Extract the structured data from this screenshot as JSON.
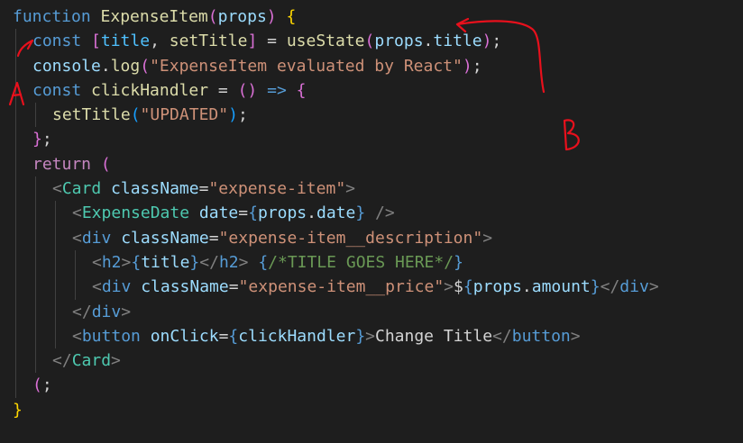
{
  "editor": {
    "language": "javascript-jsx",
    "theme": {
      "background": "#1e1e1e",
      "indent_guide": "#404040",
      "annotation_ink": "#e8101c"
    },
    "lines": [
      {
        "indent": 0,
        "tokens": [
          [
            "function",
            "#569cd6"
          ],
          [
            " ",
            "#d4d4d4"
          ],
          [
            "ExpenseItem",
            "#dcdcaa"
          ],
          [
            "(",
            "#da70d6"
          ],
          [
            "props",
            "#9cdcfe"
          ],
          [
            ")",
            "#da70d6"
          ],
          [
            " ",
            "#d4d4d4"
          ],
          [
            "{",
            "#ffd700"
          ]
        ]
      },
      {
        "indent": 1,
        "tokens": [
          [
            "const",
            "#569cd6"
          ],
          [
            " ",
            "#d4d4d4"
          ],
          [
            "[",
            "#da70d6"
          ],
          [
            "title",
            "#4fc1ff"
          ],
          [
            ", ",
            "#d4d4d4"
          ],
          [
            "setTitle",
            "#dcdcaa"
          ],
          [
            "]",
            "#da70d6"
          ],
          [
            " = ",
            "#d4d4d4"
          ],
          [
            "useState",
            "#dcdcaa"
          ],
          [
            "(",
            "#da70d6"
          ],
          [
            "props",
            "#9cdcfe"
          ],
          [
            ".",
            "#d4d4d4"
          ],
          [
            "title",
            "#9cdcfe"
          ],
          [
            ")",
            "#da70d6"
          ],
          [
            ";",
            "#d4d4d4"
          ]
        ]
      },
      {
        "indent": 1,
        "tokens": [
          [
            "console",
            "#9cdcfe"
          ],
          [
            ".",
            "#d4d4d4"
          ],
          [
            "log",
            "#dcdcaa"
          ],
          [
            "(",
            "#da70d6"
          ],
          [
            "\"ExpenseItem evaluated by React\"",
            "#ce9178"
          ],
          [
            ")",
            "#da70d6"
          ],
          [
            ";",
            "#d4d4d4"
          ]
        ]
      },
      {
        "indent": 1,
        "tokens": [
          [
            "const",
            "#569cd6"
          ],
          [
            " ",
            "#d4d4d4"
          ],
          [
            "clickHandler",
            "#dcdcaa"
          ],
          [
            " = ",
            "#d4d4d4"
          ],
          [
            "()",
            "#da70d6"
          ],
          [
            " ",
            "#d4d4d4"
          ],
          [
            "=>",
            "#569cd6"
          ],
          [
            " ",
            "#d4d4d4"
          ],
          [
            "{",
            "#da70d6"
          ]
        ]
      },
      {
        "indent": 2,
        "tokens": [
          [
            "setTitle",
            "#dcdcaa"
          ],
          [
            "(",
            "#179fff"
          ],
          [
            "\"UPDATED\"",
            "#ce9178"
          ],
          [
            ")",
            "#179fff"
          ],
          [
            ";",
            "#d4d4d4"
          ]
        ]
      },
      {
        "indent": 1,
        "tokens": [
          [
            "}",
            "#da70d6"
          ],
          [
            ";",
            "#d4d4d4"
          ]
        ]
      },
      {
        "indent": 1,
        "tokens": [
          [
            "return",
            "#c586c0"
          ],
          [
            " ",
            "#d4d4d4"
          ],
          [
            "(",
            "#da70d6"
          ]
        ]
      },
      {
        "indent": 2,
        "tokens": [
          [
            "<",
            "#808080"
          ],
          [
            "Card",
            "#4ec9b0"
          ],
          [
            " ",
            "#d4d4d4"
          ],
          [
            "className",
            "#9cdcfe"
          ],
          [
            "=",
            "#d4d4d4"
          ],
          [
            "\"expense-item\"",
            "#ce9178"
          ],
          [
            ">",
            "#808080"
          ]
        ]
      },
      {
        "indent": 3,
        "tokens": [
          [
            "<",
            "#808080"
          ],
          [
            "ExpenseDate",
            "#4ec9b0"
          ],
          [
            " ",
            "#d4d4d4"
          ],
          [
            "date",
            "#9cdcfe"
          ],
          [
            "=",
            "#d4d4d4"
          ],
          [
            "{",
            "#569cd6"
          ],
          [
            "props",
            "#9cdcfe"
          ],
          [
            ".",
            "#d4d4d4"
          ],
          [
            "date",
            "#9cdcfe"
          ],
          [
            "}",
            "#569cd6"
          ],
          [
            " ",
            "#d4d4d4"
          ],
          [
            "/>",
            "#808080"
          ]
        ]
      },
      {
        "indent": 3,
        "tokens": [
          [
            "<",
            "#808080"
          ],
          [
            "div",
            "#569cd6"
          ],
          [
            " ",
            "#d4d4d4"
          ],
          [
            "className",
            "#9cdcfe"
          ],
          [
            "=",
            "#d4d4d4"
          ],
          [
            "\"expense-item__description\"",
            "#ce9178"
          ],
          [
            ">",
            "#808080"
          ]
        ]
      },
      {
        "indent": 4,
        "tokens": [
          [
            "<",
            "#808080"
          ],
          [
            "h2",
            "#569cd6"
          ],
          [
            ">",
            "#808080"
          ],
          [
            "{",
            "#569cd6"
          ],
          [
            "title",
            "#9cdcfe"
          ],
          [
            "}",
            "#569cd6"
          ],
          [
            "</",
            "#808080"
          ],
          [
            "h2",
            "#569cd6"
          ],
          [
            ">",
            "#808080"
          ],
          [
            " ",
            "#d4d4d4"
          ],
          [
            "{",
            "#569cd6"
          ],
          [
            "/*TITLE GOES HERE*/",
            "#6a9955"
          ],
          [
            "}",
            "#569cd6"
          ]
        ]
      },
      {
        "indent": 4,
        "tokens": [
          [
            "<",
            "#808080"
          ],
          [
            "div",
            "#569cd6"
          ],
          [
            " ",
            "#d4d4d4"
          ],
          [
            "className",
            "#9cdcfe"
          ],
          [
            "=",
            "#d4d4d4"
          ],
          [
            "\"expense-item__price\"",
            "#ce9178"
          ],
          [
            ">",
            "#808080"
          ],
          [
            "$",
            "#d4d4d4"
          ],
          [
            "{",
            "#569cd6"
          ],
          [
            "props",
            "#9cdcfe"
          ],
          [
            ".",
            "#d4d4d4"
          ],
          [
            "amount",
            "#9cdcfe"
          ],
          [
            "}",
            "#569cd6"
          ],
          [
            "</",
            "#808080"
          ],
          [
            "div",
            "#569cd6"
          ],
          [
            ">",
            "#808080"
          ]
        ]
      },
      {
        "indent": 3,
        "tokens": [
          [
            "</",
            "#808080"
          ],
          [
            "div",
            "#569cd6"
          ],
          [
            ">",
            "#808080"
          ]
        ]
      },
      {
        "indent": 3,
        "tokens": [
          [
            "<",
            "#808080"
          ],
          [
            "button",
            "#569cd6"
          ],
          [
            " ",
            "#d4d4d4"
          ],
          [
            "onClick",
            "#9cdcfe"
          ],
          [
            "=",
            "#d4d4d4"
          ],
          [
            "{",
            "#569cd6"
          ],
          [
            "clickHandler",
            "#9cdcfe"
          ],
          [
            "}",
            "#569cd6"
          ],
          [
            ">",
            "#808080"
          ],
          [
            "Change Title",
            "#d4d4d4"
          ],
          [
            "</",
            "#808080"
          ],
          [
            "button",
            "#569cd6"
          ],
          [
            ">",
            "#808080"
          ]
        ]
      },
      {
        "indent": 2,
        "tokens": [
          [
            "</",
            "#808080"
          ],
          [
            "Card",
            "#4ec9b0"
          ],
          [
            ">",
            "#808080"
          ]
        ]
      },
      {
        "indent": 1,
        "tokens": [
          [
            "(",
            "#da70d6"
          ],
          [
            ";",
            "#d4d4d4"
          ]
        ]
      },
      {
        "indent": 0,
        "tokens": [
          [
            "}",
            "#ffd700"
          ]
        ]
      }
    ]
  },
  "annotations": {
    "label_a": "A",
    "label_b": "B"
  }
}
